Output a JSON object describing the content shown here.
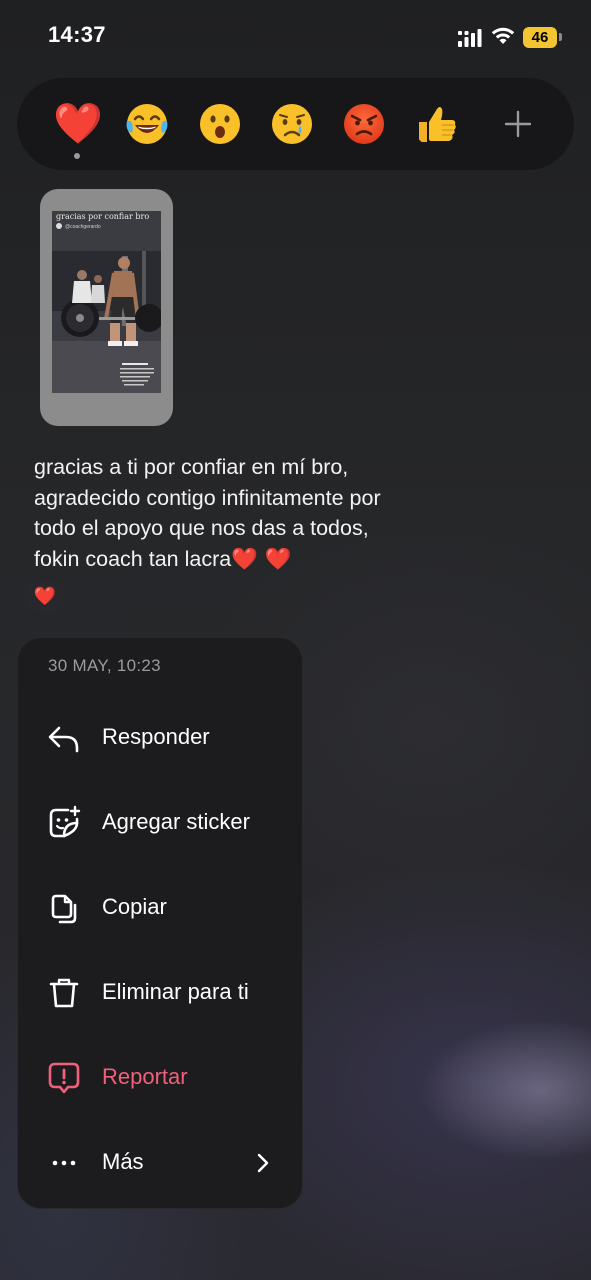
{
  "status_bar": {
    "time": "14:37",
    "battery": "46",
    "battery_color": "#f2c531"
  },
  "reactions": [
    {
      "name": "red-heart",
      "glyph": "❤️"
    },
    {
      "name": "face-with-tears-of-joy"
    },
    {
      "name": "surprised-face"
    },
    {
      "name": "crying-face"
    },
    {
      "name": "angry-face"
    },
    {
      "name": "thumbs-up"
    },
    {
      "name": "add-reaction"
    }
  ],
  "story": {
    "caption": "gracias por confiar bro",
    "user": "@coachgerardo",
    "icon": "shared-story-thumbnail"
  },
  "message": {
    "text": "gracias a ti por confiar en mí bro, agradecido contigo infinitamente por todo el apoyo que nos das a todos, fokin coach tan lacra",
    "trailing_hearts": "❤️ ❤️",
    "reaction": "❤️"
  },
  "menu": {
    "timestamp": "30 MAY, 10:23",
    "items": [
      {
        "label": "Responder",
        "icon": "reply-icon"
      },
      {
        "label": "Agregar sticker",
        "icon": "add-sticker-icon"
      },
      {
        "label": "Copiar",
        "icon": "copy-icon"
      },
      {
        "label": "Eliminar para ti",
        "icon": "trash-icon"
      },
      {
        "label": "Reportar",
        "icon": "report-icon",
        "color": "#f0607a"
      },
      {
        "label": "Más",
        "icon": "more-icon"
      }
    ]
  },
  "colors": {
    "danger": "#f0607a",
    "heart": "#e2261c",
    "menu_background": "#1c1c1e"
  }
}
